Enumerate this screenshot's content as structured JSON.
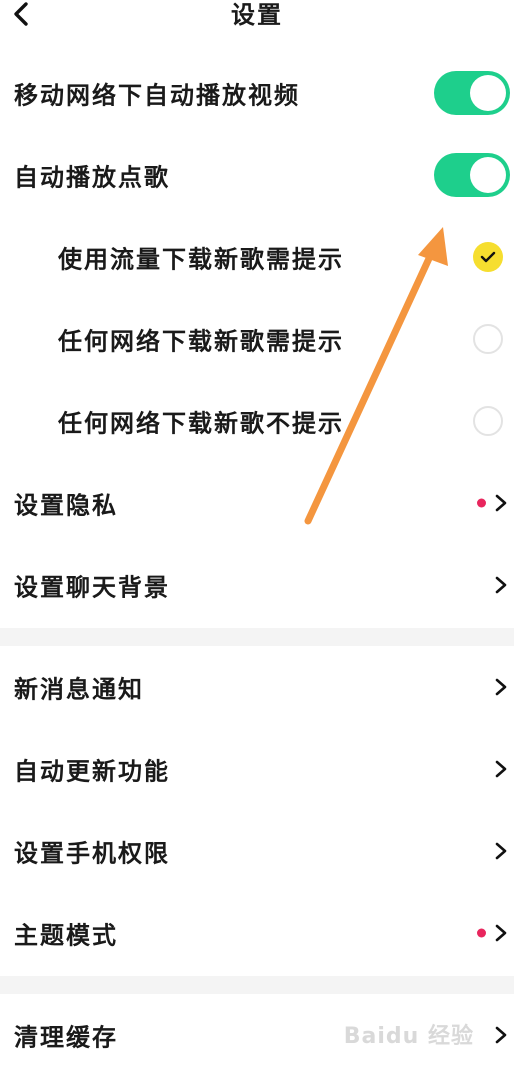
{
  "header": {
    "title": "设置",
    "back_icon": "chevron-left-icon"
  },
  "rows": [
    {
      "label": "移动网络下自动播放视频",
      "control": "toggle",
      "on": true
    },
    {
      "label": "自动播放点歌",
      "control": "toggle",
      "on": true
    },
    {
      "label": "使用流量下载新歌需提示",
      "control": "radio",
      "checked": true
    },
    {
      "label": "任何网络下载新歌需提示",
      "control": "radio",
      "checked": false
    },
    {
      "label": "任何网络下载新歌不提示",
      "control": "radio",
      "checked": false
    },
    {
      "label": "设置隐私",
      "control": "chevron",
      "dot": true
    },
    {
      "label": "设置聊天背景",
      "control": "chevron",
      "dot": false
    },
    {
      "label": "新消息通知",
      "control": "chevron",
      "dot": false
    },
    {
      "label": "自动更新功能",
      "control": "chevron",
      "dot": false
    },
    {
      "label": "设置手机权限",
      "control": "chevron",
      "dot": false
    },
    {
      "label": "主题模式",
      "control": "chevron",
      "dot": true
    },
    {
      "label": "清理缓存",
      "control": "chevron",
      "dot": false
    }
  ],
  "colors": {
    "toggle_on": "#1ecf8c",
    "radio_checked": "#f6de2f",
    "notice_dot": "#e8265d",
    "annotation_arrow": "#f4963f"
  },
  "watermark": "Baidu 经验"
}
